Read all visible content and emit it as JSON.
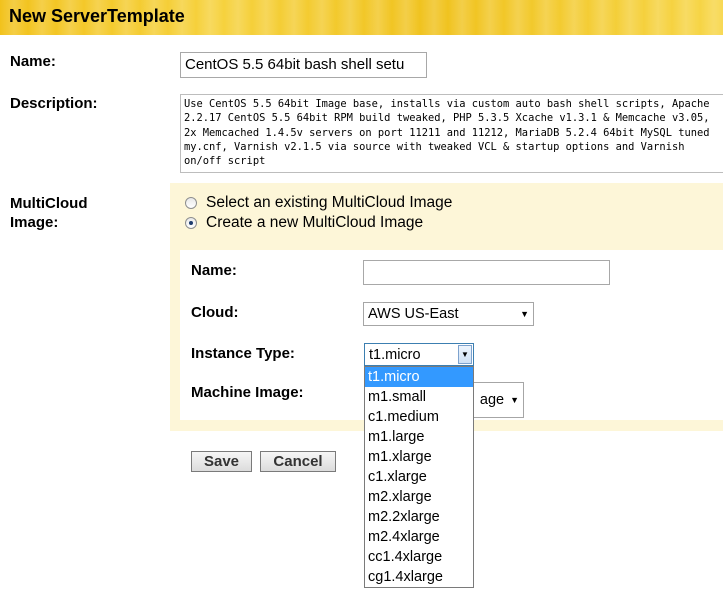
{
  "header": {
    "title": "New ServerTemplate"
  },
  "form": {
    "name_label": "Name:",
    "name_value": "CentOS 5.5 64bit bash shell setu",
    "description_label": "Description:",
    "description_value": "Use CentOS 5.5 64bit Image base, installs via custom auto bash shell scripts, Apache 2.2.17 CentOS 5.5 64bit RPM build tweaked, PHP 5.3.5 Xcache v1.3.1 & Memcache v3.05, 2x Memcached 1.4.5v servers on port 11211 and 11212, MariaDB 5.2.4 64bit MySQL tuned my.cnf, Varnish v2.1.5 via source with tweaked VCL & startup options and Varnish on/off script",
    "multicloud_label_line1": "MultiCloud",
    "multicloud_label_line2": "Image:",
    "radio_existing": "Select an existing MultiCloud Image",
    "radio_new": "Create a new MultiCloud Image"
  },
  "new_image": {
    "name_label": "Name:",
    "name_value": "",
    "cloud_label": "Cloud:",
    "cloud_value": "AWS US-East",
    "instance_type_label": "Instance Type:",
    "instance_type_value": "t1.micro",
    "machine_image_label": "Machine Image:",
    "machine_image_partial": "age"
  },
  "buttons": {
    "save": "Save",
    "cancel": "Cancel"
  },
  "instance_type_options": [
    "t1.micro",
    "m1.small",
    "c1.medium",
    "m1.large",
    "m1.xlarge",
    "c1.xlarge",
    "m2.xlarge",
    "m2.2xlarge",
    "m2.4xlarge",
    "cc1.4xlarge",
    "cg1.4xlarge"
  ],
  "colors": {
    "header": "#f2c21b",
    "panel": "#fdf6d8",
    "selection": "#3399ff"
  }
}
